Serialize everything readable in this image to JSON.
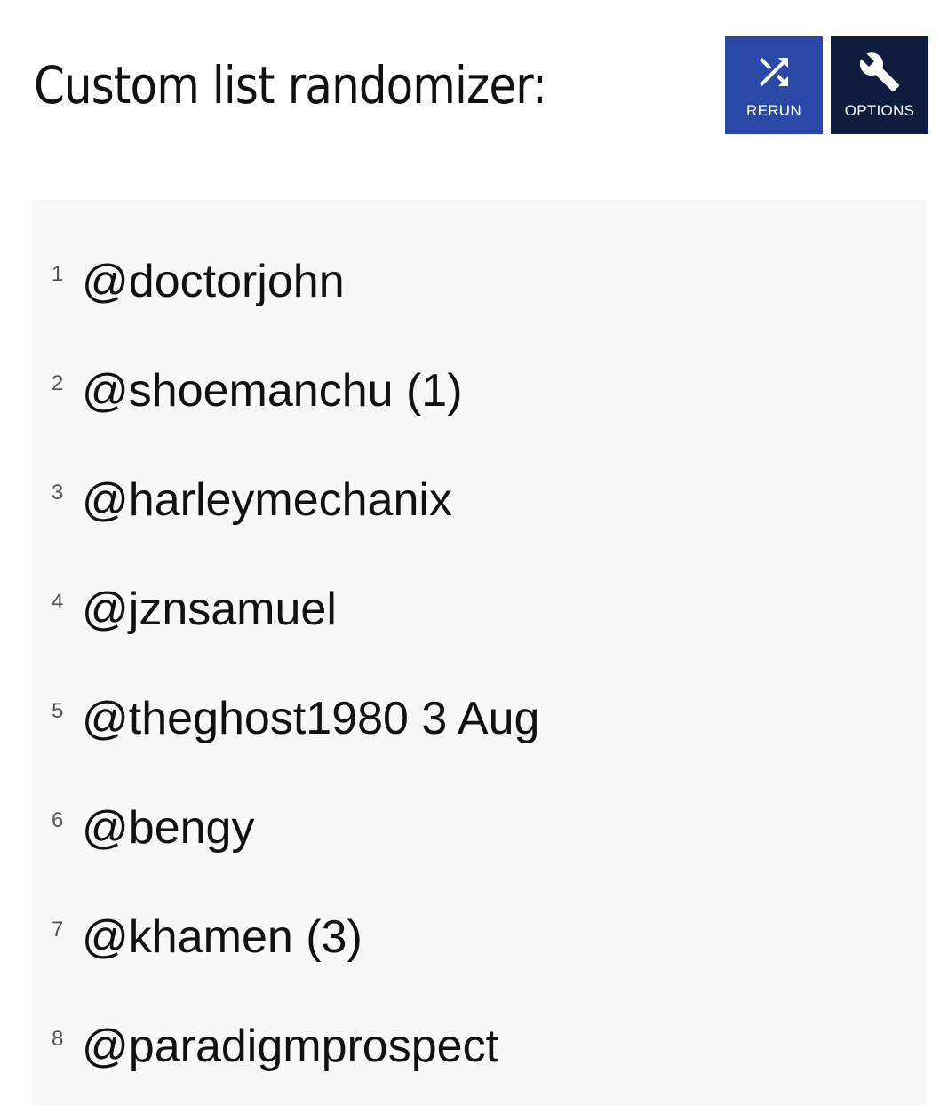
{
  "page": {
    "title": "Custom list randomizer:"
  },
  "toolbar": {
    "rerun": {
      "label": "RERUN",
      "icon": "shuffle-icon",
      "color": "#2a49a6"
    },
    "options": {
      "label": "OPTIONS",
      "icon": "wrench-icon",
      "color": "#101c3e"
    }
  },
  "list": {
    "background": "#f8f8f8",
    "items": [
      {
        "number": "1",
        "text": "@doctorjohn"
      },
      {
        "number": "2",
        "text": "@shoemanchu (1)"
      },
      {
        "number": "3",
        "text": "@harleymechanix"
      },
      {
        "number": "4",
        "text": "@jznsamuel"
      },
      {
        "number": "5",
        "text": "@theghost1980 3 Aug"
      },
      {
        "number": "6",
        "text": "@bengy"
      },
      {
        "number": "7",
        "text": "@khamen (3)"
      },
      {
        "number": "8",
        "text": "@paradigmprospect"
      }
    ]
  }
}
